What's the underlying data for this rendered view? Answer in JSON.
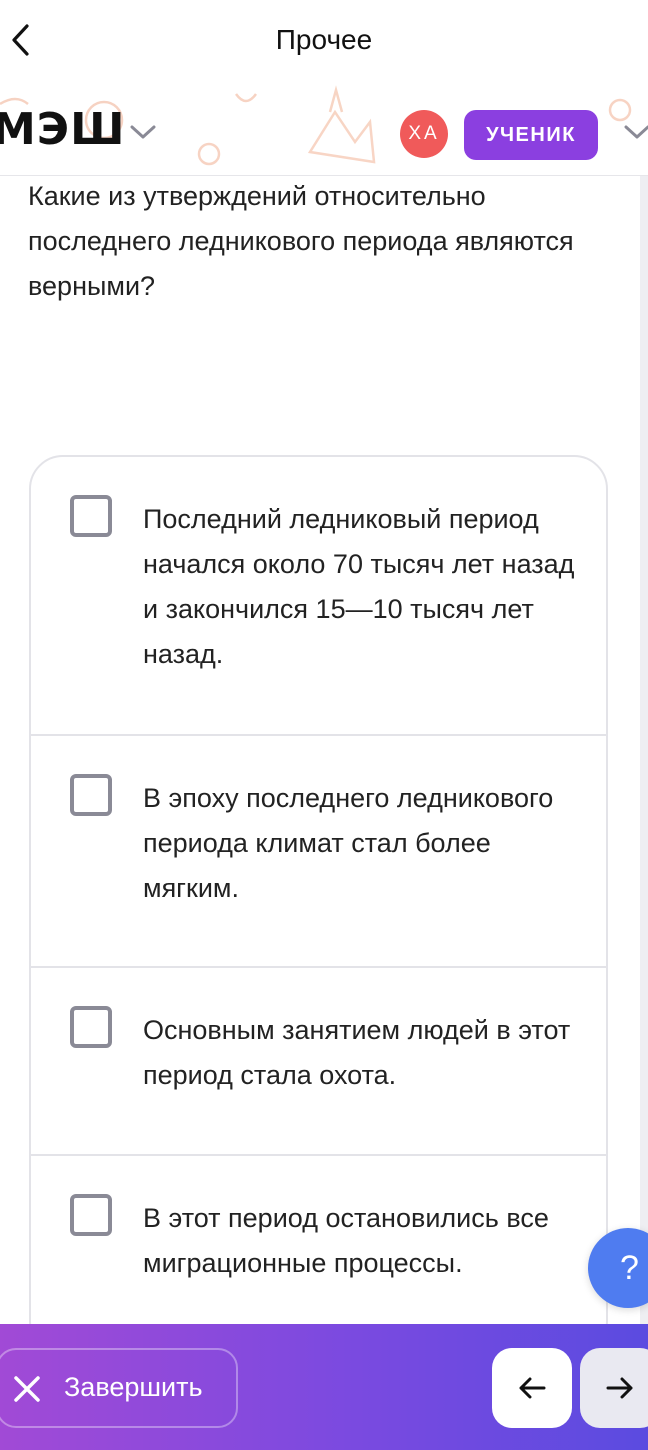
{
  "topbar": {
    "title": "Прочее"
  },
  "header": {
    "logo": "МЭШ",
    "avatar_initials": "ХА",
    "role": "УЧЕНИК"
  },
  "question": {
    "text": "Какие из утверждений относительно последнего ледникового периода являются верными?"
  },
  "options": [
    {
      "text": "Последний ледниковый период начался около 70 тысяч лет назад и закончился 15—10 тысяч лет назад.",
      "checked": false
    },
    {
      "text": "В эпоху последнего ледникового периода климат стал более мягким.",
      "checked": false
    },
    {
      "text": "Основным занятием людей в этот период стала охота.",
      "checked": false
    },
    {
      "text": "В этот период остановились все миграционные процессы.",
      "checked": false
    }
  ],
  "help": {
    "label": "?"
  },
  "bottom_bar": {
    "finish_label": "Завершить"
  },
  "colors": {
    "role_badge": "#8b3fe0",
    "avatar": "#f05a5a",
    "help_button": "#4f7cf0",
    "bottom_gradient_start": "#a14ad6",
    "bottom_gradient_end": "#5b4be0",
    "decoration": "#f5a98a"
  }
}
